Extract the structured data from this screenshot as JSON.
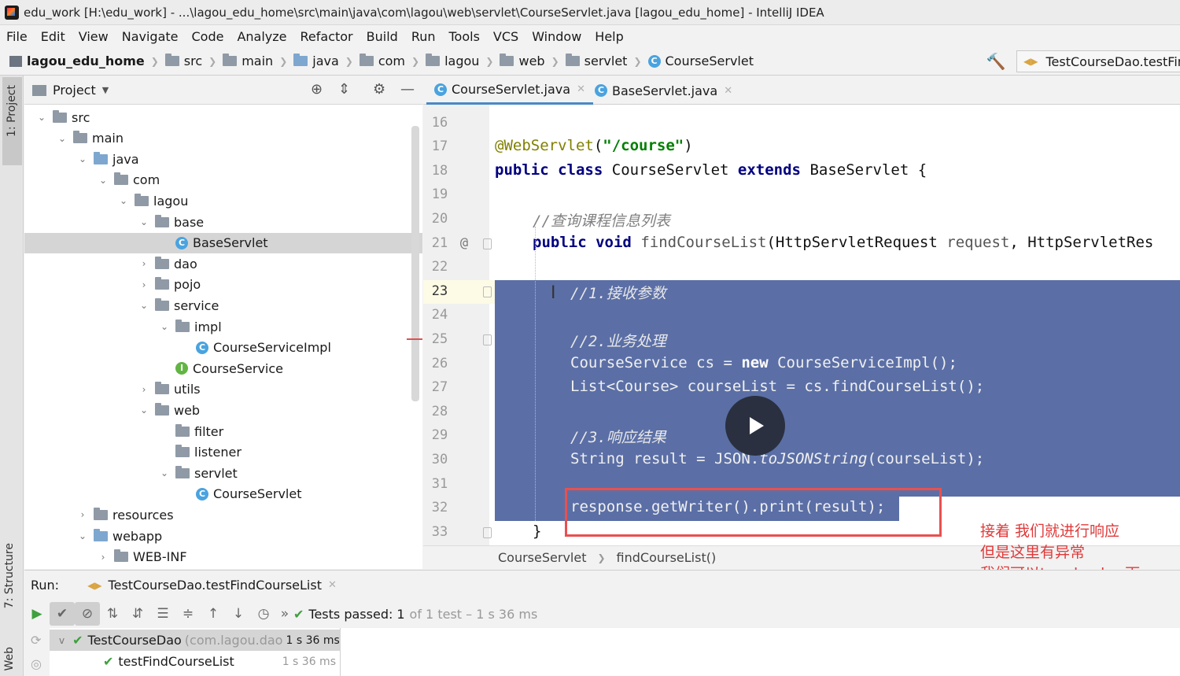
{
  "window": {
    "title": "edu_work [H:\\edu_work] - ...\\lagou_edu_home\\src\\main\\java\\com\\lagou\\web\\servlet\\CourseServlet.java [lagou_edu_home] - IntelliJ IDEA"
  },
  "menu": [
    "File",
    "Edit",
    "View",
    "Navigate",
    "Code",
    "Analyze",
    "Refactor",
    "Build",
    "Run",
    "Tools",
    "VCS",
    "Window",
    "Help"
  ],
  "nav": {
    "crumbs": [
      "lagou_edu_home",
      "src",
      "main",
      "java",
      "com",
      "lagou",
      "web",
      "servlet",
      "CourseServlet"
    ],
    "run_config": "TestCourseDao.testFindCourseList"
  },
  "side_strip": {
    "project": "1: Project",
    "structure": "7: Structure",
    "web": "Web"
  },
  "project_panel": {
    "title": "Project",
    "tree": [
      {
        "label": "src",
        "arrow": "v",
        "icon": "folder"
      },
      {
        "label": "main",
        "arrow": "v",
        "icon": "folder"
      },
      {
        "label": "java",
        "arrow": "v",
        "icon": "folder-blue"
      },
      {
        "label": "com",
        "arrow": "v",
        "icon": "folder"
      },
      {
        "label": "lagou",
        "arrow": "v",
        "icon": "folder"
      },
      {
        "label": "base",
        "arrow": "v",
        "icon": "folder"
      },
      {
        "label": "BaseServlet",
        "arrow": "",
        "icon": "class",
        "selected": true
      },
      {
        "label": "dao",
        "arrow": ">",
        "icon": "folder"
      },
      {
        "label": "pojo",
        "arrow": ">",
        "icon": "folder"
      },
      {
        "label": "service",
        "arrow": "v",
        "icon": "folder"
      },
      {
        "label": "impl",
        "arrow": "v",
        "icon": "folder"
      },
      {
        "label": "CourseServiceImpl",
        "arrow": "",
        "icon": "class"
      },
      {
        "label": "CourseService",
        "arrow": "",
        "icon": "interface"
      },
      {
        "label": "utils",
        "arrow": ">",
        "icon": "folder"
      },
      {
        "label": "web",
        "arrow": "v",
        "icon": "folder"
      },
      {
        "label": "filter",
        "arrow": "",
        "icon": "folder"
      },
      {
        "label": "listener",
        "arrow": "",
        "icon": "folder"
      },
      {
        "label": "servlet",
        "arrow": "v",
        "icon": "folder"
      },
      {
        "label": "CourseServlet",
        "arrow": "",
        "icon": "class"
      },
      {
        "label": "resources",
        "arrow": ">",
        "icon": "folder"
      },
      {
        "label": "webapp",
        "arrow": "v",
        "icon": "folder-blue"
      },
      {
        "label": "WEB-INF",
        "arrow": ">",
        "icon": "folder"
      }
    ]
  },
  "editor": {
    "tabs": [
      {
        "label": "CourseServlet.java",
        "active": true
      },
      {
        "label": "BaseServlet.java",
        "active": false
      }
    ],
    "line_numbers": [
      "16",
      "17",
      "18",
      "19",
      "20",
      "21",
      "22",
      "23",
      "24",
      "25",
      "26",
      "27",
      "28",
      "29",
      "30",
      "31",
      "32",
      "33"
    ],
    "gutter_marker": "@",
    "code": {
      "l17_ann": "@WebServlet",
      "l17_open": "(",
      "l17_str": "\"/course\"",
      "l17_close": ")",
      "l18_public": "public",
      "l18_class": "class",
      "l18_name": "CourseServlet",
      "l18_extends": "extends",
      "l18_rest": "BaseServlet {",
      "l20_comment": "//查询课程信息列表",
      "l21_public": "public",
      "l21_void": "void",
      "l21_method": "findCourseList",
      "l21_type1": "(HttpServletRequest ",
      "l21_p1": "request",
      "l21_rest": ", HttpServletRes",
      "l23_comment": "//1.接收参数",
      "l25_comment": "//2.业务处理",
      "l26_a": "CourseService cs = ",
      "l26_new": "new",
      "l26_b": " CourseServiceImpl();",
      "l27": "List<Course> courseList = cs.findCourseList();",
      "l29_comment": "//3.响应结果",
      "l30_a": "String result = JSON.",
      "l30_static": "toJSONString",
      "l30_b": "(courseList);",
      "l32": "response.getWriter().print(result);",
      "l33": "}"
    },
    "breadcrumb": [
      "CourseServlet",
      "findCourseList()"
    ]
  },
  "annotation": {
    "lines": [
      "接着 我们就进行响应",
      "但是这里有异常",
      "我们可以try chach一下"
    ],
    "color": "#e03a3a"
  },
  "run_panel": {
    "label": "Run:",
    "tab": "TestCourseDao.testFindCourseList",
    "status_label": "Tests passed:",
    "status_count": "1",
    "status_detail": "of 1 test – 1 s 36 ms",
    "results": [
      {
        "name": "TestCourseDao",
        "detail": "(com.lagou.dao",
        "time": "1 s 36 ms"
      },
      {
        "name": "testFindCourseList",
        "detail": "",
        "time": "1 s 36 ms"
      }
    ]
  },
  "colors": {
    "selection": "#5b6fa6",
    "highlight_box": "#e8504f",
    "keyword": "#000080",
    "string": "#008000",
    "annotation": "#808000"
  }
}
